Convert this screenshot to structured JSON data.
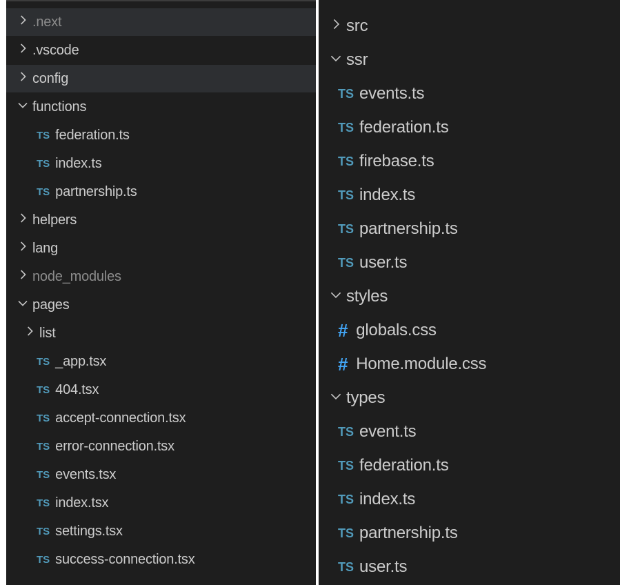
{
  "left_panel": {
    "items": [
      {
        "label": ".next",
        "type": "folder",
        "expanded": false,
        "indent": 0,
        "highlight": true,
        "dim": true
      },
      {
        "label": ".vscode",
        "type": "folder",
        "expanded": false,
        "indent": 0
      },
      {
        "label": "config",
        "type": "folder",
        "expanded": false,
        "indent": 0,
        "highlight": true
      },
      {
        "label": "functions",
        "type": "folder",
        "expanded": true,
        "indent": 0
      },
      {
        "label": "federation.ts",
        "type": "ts",
        "indent": 1
      },
      {
        "label": "index.ts",
        "type": "ts",
        "indent": 1
      },
      {
        "label": "partnership.ts",
        "type": "ts",
        "indent": 1
      },
      {
        "label": "helpers",
        "type": "folder",
        "expanded": false,
        "indent": 0
      },
      {
        "label": "lang",
        "type": "folder",
        "expanded": false,
        "indent": 0
      },
      {
        "label": "node_modules",
        "type": "folder",
        "expanded": false,
        "indent": 0,
        "dim": true
      },
      {
        "label": "pages",
        "type": "folder",
        "expanded": true,
        "indent": 0
      },
      {
        "label": "list",
        "type": "folder",
        "expanded": false,
        "indent": 1
      },
      {
        "label": "_app.tsx",
        "type": "ts",
        "indent": 1
      },
      {
        "label": "404.tsx",
        "type": "ts",
        "indent": 1
      },
      {
        "label": "accept-connection.tsx",
        "type": "ts",
        "indent": 1
      },
      {
        "label": "error-connection.tsx",
        "type": "ts",
        "indent": 1
      },
      {
        "label": "events.tsx",
        "type": "ts",
        "indent": 1
      },
      {
        "label": "index.tsx",
        "type": "ts",
        "indent": 1
      },
      {
        "label": "settings.tsx",
        "type": "ts",
        "indent": 1
      },
      {
        "label": "success-connection.tsx",
        "type": "ts",
        "indent": 1
      }
    ]
  },
  "right_panel": {
    "items": [
      {
        "label": "src",
        "type": "folder",
        "expanded": false,
        "indent": 0
      },
      {
        "label": "ssr",
        "type": "folder",
        "expanded": true,
        "indent": 0
      },
      {
        "label": "events.ts",
        "type": "ts",
        "indent": 1
      },
      {
        "label": "federation.ts",
        "type": "ts",
        "indent": 1
      },
      {
        "label": "firebase.ts",
        "type": "ts",
        "indent": 1
      },
      {
        "label": "index.ts",
        "type": "ts",
        "indent": 1
      },
      {
        "label": "partnership.ts",
        "type": "ts",
        "indent": 1
      },
      {
        "label": "user.ts",
        "type": "ts",
        "indent": 1
      },
      {
        "label": "styles",
        "type": "folder",
        "expanded": true,
        "indent": 0
      },
      {
        "label": "globals.css",
        "type": "css",
        "indent": 1
      },
      {
        "label": "Home.module.css",
        "type": "css",
        "indent": 1
      },
      {
        "label": "types",
        "type": "folder",
        "expanded": true,
        "indent": 0
      },
      {
        "label": "event.ts",
        "type": "ts",
        "indent": 1
      },
      {
        "label": "federation.ts",
        "type": "ts",
        "indent": 1
      },
      {
        "label": "index.ts",
        "type": "ts",
        "indent": 1
      },
      {
        "label": "partnership.ts",
        "type": "ts",
        "indent": 1
      },
      {
        "label": "user.ts",
        "type": "ts",
        "indent": 1
      }
    ]
  },
  "icons": {
    "chevron_right": "›",
    "chevron_down": "⌄",
    "ts_badge": "TS",
    "css_badge": "#"
  },
  "colors": {
    "background": "#1e1e1e",
    "text": "#cccccc",
    "dim_text": "#8c8c8c",
    "ts_icon": "#519aba",
    "css_icon": "#42a5f5",
    "highlight_row": "#2d2f32"
  }
}
